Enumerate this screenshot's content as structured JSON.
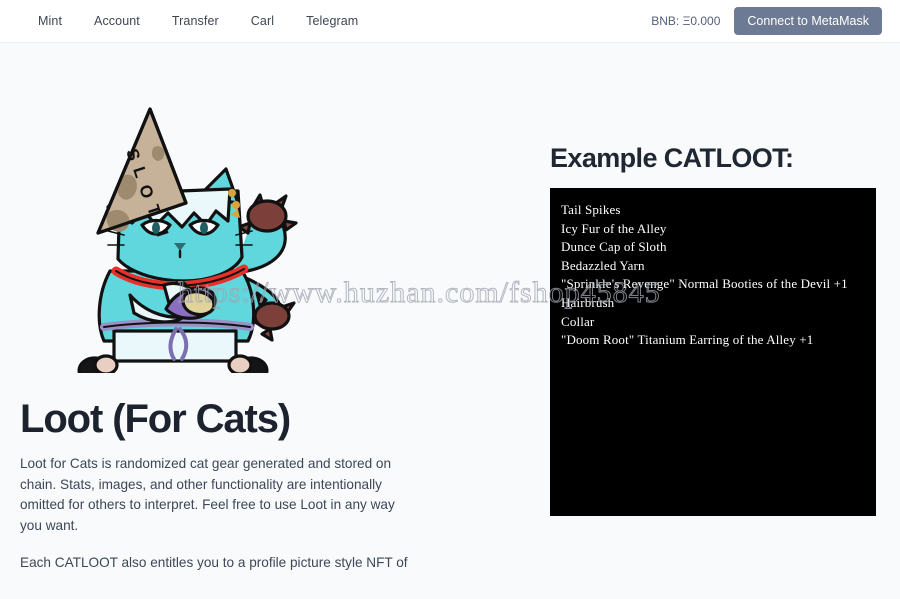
{
  "navbar": {
    "links": [
      {
        "label": "Mint",
        "name": "nav-link-mint"
      },
      {
        "label": "Account",
        "name": "nav-link-account"
      },
      {
        "label": "Transfer",
        "name": "nav-link-transfer"
      },
      {
        "label": "Carl",
        "name": "nav-link-carl"
      },
      {
        "label": "Telegram",
        "name": "nav-link-telegram"
      }
    ],
    "balance_label": "BNB: Ξ0.000",
    "connect_button": "Connect to MetaMask",
    "button_color": "#6c7a93",
    "background": "#ffffff"
  },
  "hero": {
    "title": "Loot (For Cats)",
    "paragraphs": [
      "Loot for Cats is randomized cat gear generated and stored on chain. Stats, images, and other functionality are intentionally omitted for others to interpret. Feel free to use Loot in any way you want.",
      "Each CATLOOT also entitles you to a profile picture style NFT of"
    ],
    "artwork": {
      "name": "sloth-cat-illustration",
      "hat_text": "SLOTH",
      "body_color": "#5fd7dd",
      "hat_color": "#c6b298",
      "collar_color": "#e8302a"
    }
  },
  "loot_panel": {
    "heading": "Example CATLOOT:",
    "background": "#000000",
    "text_color": "#ffffff",
    "items": [
      "Tail Spikes",
      "Icy Fur of the Alley",
      "Dunce Cap of Sloth",
      "Bedazzled Yarn",
      "\"Sprinkle's Revenge\" Normal Booties of the Devil +1",
      "Hairbrush",
      "Collar",
      "\"Doom Root\" Titanium Earring of the Alley +1"
    ]
  },
  "watermark": {
    "text": "https://www.huzhan.com/fshop45845"
  },
  "page": {
    "background": "#f8fafc"
  }
}
